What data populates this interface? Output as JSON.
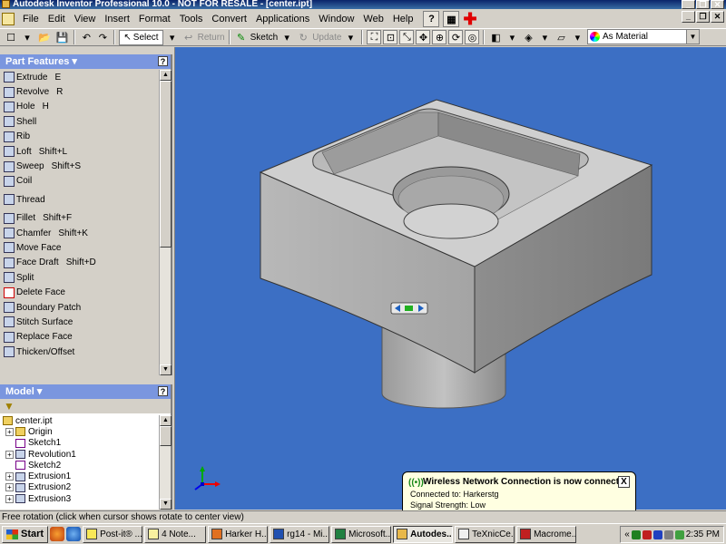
{
  "window": {
    "title": "Autodesk Inventor Professional 10.0 - NOT FOR RESALE - [center.ipt]"
  },
  "menu": {
    "items": [
      "File",
      "Edit",
      "View",
      "Insert",
      "Format",
      "Tools",
      "Convert",
      "Applications",
      "Window",
      "Web",
      "Help"
    ]
  },
  "toolbar": {
    "select_label": "Select",
    "return_label": "Return",
    "sketch_label": "Sketch",
    "update_label": "Update",
    "material_label": "As Material"
  },
  "part_features": {
    "header": "Part Features",
    "help": "?",
    "items": [
      {
        "label": "Extrude",
        "shortcut": "E"
      },
      {
        "label": "Revolve",
        "shortcut": "R"
      },
      {
        "label": "Hole",
        "shortcut": "H"
      },
      {
        "label": "Shell",
        "shortcut": ""
      },
      {
        "label": "Rib",
        "shortcut": ""
      },
      {
        "label": "Loft",
        "shortcut": "Shift+L"
      },
      {
        "label": "Sweep",
        "shortcut": "Shift+S"
      },
      {
        "label": "Coil",
        "shortcut": ""
      },
      {
        "label": "Thread",
        "shortcut": ""
      },
      {
        "label": "Fillet",
        "shortcut": "Shift+F"
      },
      {
        "label": "Chamfer",
        "shortcut": "Shift+K"
      },
      {
        "label": "Move Face",
        "shortcut": ""
      },
      {
        "label": "Face Draft",
        "shortcut": "Shift+D"
      },
      {
        "label": "Split",
        "shortcut": ""
      },
      {
        "label": "Delete Face",
        "shortcut": ""
      },
      {
        "label": "Boundary Patch",
        "shortcut": ""
      },
      {
        "label": "Stitch Surface",
        "shortcut": ""
      },
      {
        "label": "Replace Face",
        "shortcut": ""
      },
      {
        "label": "Thicken/Offset",
        "shortcut": ""
      }
    ]
  },
  "model": {
    "header": "Model",
    "help": "?",
    "root": "center.ipt",
    "items": [
      {
        "label": "Origin",
        "expandable": true
      },
      {
        "label": "Sketch1",
        "expandable": false
      },
      {
        "label": "Revolution1",
        "expandable": true
      },
      {
        "label": "Sketch2",
        "expandable": false
      },
      {
        "label": "Extrusion1",
        "expandable": true
      },
      {
        "label": "Extrusion2",
        "expandable": true
      },
      {
        "label": "Extrusion3",
        "expandable": true
      }
    ]
  },
  "notification": {
    "title": "Wireless Network Connection is now connected",
    "line1": "Connected to: Harkerstg",
    "line2": "Signal Strength: Low",
    "close": "X"
  },
  "statusbar": {
    "text": "Free rotation (click when cursor shows rotate to center view)"
  },
  "taskbar": {
    "start_label": "Start",
    "tasks": [
      "Post-it® ...",
      "4 Note...",
      "Harker H...",
      "rg14 - Mi...",
      "Microsoft...",
      "Autodes...",
      "TeXnicCe...",
      "Macrome..."
    ],
    "active_index": 5,
    "time": "2:35 PM"
  },
  "colors": {
    "viewport": "#3c6fc4",
    "panel_header": "#7a96df",
    "model_face_light": "#c8c8c8",
    "model_face_dark": "#9a9a9a"
  }
}
